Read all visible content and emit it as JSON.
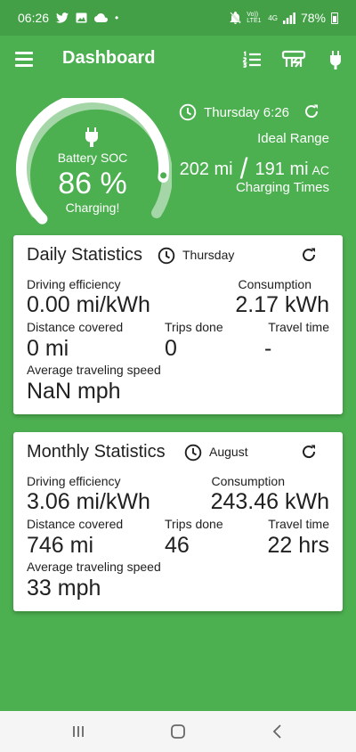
{
  "status_bar": {
    "time": "06:26",
    "battery": "78%",
    "network_small": "Vo)) LTE1",
    "network_type": "4G"
  },
  "app_bar": {
    "title": "Dashboard",
    "icons": [
      "menu-icon",
      "list-icon",
      "charger-icon",
      "plug-icon"
    ]
  },
  "hero": {
    "soc_label": "Battery SOC",
    "soc_value": "86 %",
    "soc_percent": 86,
    "soc_status": "Charging!",
    "day_time": "Thursday 6:26",
    "ideal_range_label": "Ideal Range",
    "range_ideal": "202 mi",
    "range_rated": "191 mi",
    "range_mode": "AC",
    "charging_times": "Charging Times"
  },
  "daily": {
    "title": "Daily Statistics",
    "day": "Thursday",
    "driving_efficiency_label": "Driving efficiency",
    "driving_efficiency_value": "0.00 mi/kWh",
    "consumption_label": "Consumption",
    "consumption_value": "2.17 kWh",
    "distance_label": "Distance covered",
    "distance_value": "0 mi",
    "trips_label": "Trips done",
    "trips_value": "0",
    "travel_label": "Travel time",
    "travel_value": "-",
    "speed_label": "Average traveling speed",
    "speed_value": "NaN mph"
  },
  "monthly": {
    "title": "Monthly Statistics",
    "month": "August",
    "driving_efficiency_label": "Driving efficiency",
    "driving_efficiency_value": "3.06 mi/kWh",
    "consumption_label": "Consumption",
    "consumption_value": "243.46 kWh",
    "distance_label": "Distance covered",
    "distance_value": "746 mi",
    "trips_label": "Trips done",
    "trips_value": "46",
    "travel_label": "Travel time",
    "travel_value": "22 hrs",
    "speed_label": "Average traveling speed",
    "speed_value": "33 mph"
  },
  "colors": {
    "background": "#4CAF50",
    "status_bar": "#43A047",
    "card": "#FFFFFF",
    "gauge_track": "#A5D6A7",
    "gauge_fill": "#FFFFFF",
    "nav_bar": "#F5F5F5"
  }
}
